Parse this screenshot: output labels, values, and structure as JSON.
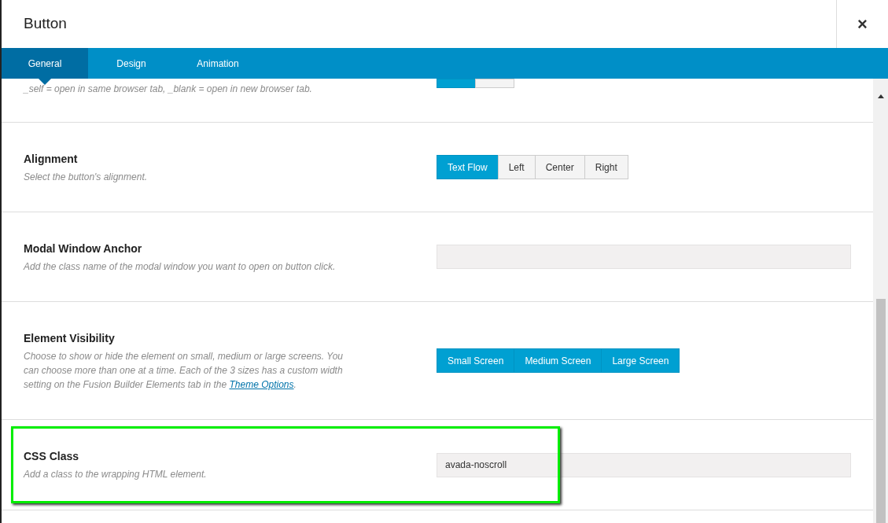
{
  "window": {
    "title": "Button",
    "close": "×"
  },
  "tabs": [
    {
      "label": "General",
      "selected": true
    },
    {
      "label": "Design",
      "selected": false
    },
    {
      "label": "Animation",
      "selected": false
    }
  ],
  "options": [
    {
      "kind": "buttons",
      "description": "_self = open in same browser tab, _blank = open in new browser tab.",
      "cut": true,
      "buttons": [
        {
          "selected": true
        },
        {
          "selected": false
        }
      ]
    },
    {
      "kind": "buttons",
      "title": "Alignment",
      "description": "Select the button's alignment.",
      "buttons": [
        {
          "label": "Text Flow",
          "selected": true
        },
        {
          "label": "Left",
          "selected": false
        },
        {
          "label": "Center",
          "selected": false
        },
        {
          "label": "Right",
          "selected": false
        }
      ]
    },
    {
      "kind": "text",
      "title": "Modal Window Anchor",
      "description": "Add the class name of the modal window you want to open on button click."
    },
    {
      "kind": "buttons",
      "title": "Element Visibility",
      "description": "Choose to show or hide the element on small, medium or large screens. You can choose more than one at a time. Each of the 3 sizes has a custom width setting on the Fusion Builder Elements tab in the ",
      "link": "Theme Options",
      "description_end": ".",
      "buttons": [
        {
          "label": "Small Screen",
          "selected": true
        },
        {
          "label": "Medium Screen",
          "selected": true
        },
        {
          "label": "Large Screen",
          "selected": true
        }
      ]
    },
    {
      "kind": "text",
      "title": "CSS Class",
      "description": "Add a class to the wrapping HTML element.",
      "value": "avada-noscroll",
      "highlighted": true
    }
  ]
}
